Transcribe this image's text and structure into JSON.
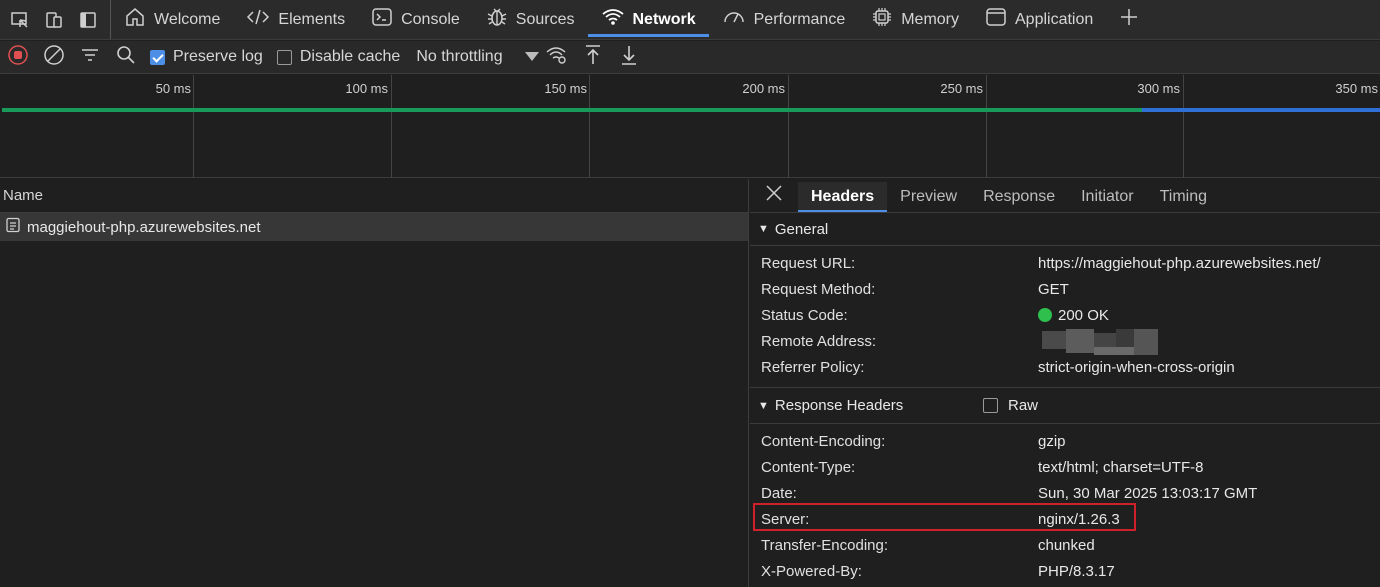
{
  "tabs": [
    {
      "label": "Welcome",
      "icon": "home-icon"
    },
    {
      "label": "Elements",
      "icon": "code-icon"
    },
    {
      "label": "Console",
      "icon": "console-icon"
    },
    {
      "label": "Sources",
      "icon": "bug-icon"
    },
    {
      "label": "Network",
      "icon": "wifi-icon",
      "active": true
    },
    {
      "label": "Performance",
      "icon": "gauge-icon"
    },
    {
      "label": "Memory",
      "icon": "chip-icon"
    },
    {
      "label": "Application",
      "icon": "window-icon"
    }
  ],
  "toolbar": {
    "preserve_log": {
      "label": "Preserve log",
      "checked": true
    },
    "disable_cache": {
      "label": "Disable cache",
      "checked": false
    },
    "throttling": "No throttling"
  },
  "timeline": {
    "ticks": [
      "50 ms",
      "100 ms",
      "150 ms",
      "200 ms",
      "250 ms",
      "300 ms",
      "350 ms"
    ],
    "colors": {
      "green": "#1a9a5a",
      "blue": "#2f6fd6"
    }
  },
  "request_list": {
    "column": "Name",
    "rows": [
      {
        "name": "maggiehout-php.azurewebsites.net"
      }
    ]
  },
  "details": {
    "tabs": [
      "Headers",
      "Preview",
      "Response",
      "Initiator",
      "Timing"
    ],
    "active_tab": "Headers",
    "general": {
      "title": "General",
      "request_url": {
        "key": "Request URL:",
        "value": "https://maggiehout-php.azurewebsites.net/"
      },
      "request_method": {
        "key": "Request Method:",
        "value": "GET"
      },
      "status_code": {
        "key": "Status Code:",
        "value": "200 OK",
        "color": "#2fbf4d"
      },
      "remote_address": {
        "key": "Remote Address:",
        "value": ""
      },
      "referrer_policy": {
        "key": "Referrer Policy:",
        "value": "strict-origin-when-cross-origin"
      }
    },
    "response_headers": {
      "title": "Response Headers",
      "raw_label": "Raw",
      "items": [
        {
          "key": "Content-Encoding:",
          "value": "gzip"
        },
        {
          "key": "Content-Type:",
          "value": "text/html; charset=UTF-8"
        },
        {
          "key": "Date:",
          "value": "Sun, 30 Mar 2025 13:03:17 GMT"
        },
        {
          "key": "Server:",
          "value": "nginx/1.26.3",
          "highlighted": true
        },
        {
          "key": "Transfer-Encoding:",
          "value": "chunked"
        },
        {
          "key": "X-Powered-By:",
          "value": "PHP/8.3.17"
        }
      ]
    }
  }
}
